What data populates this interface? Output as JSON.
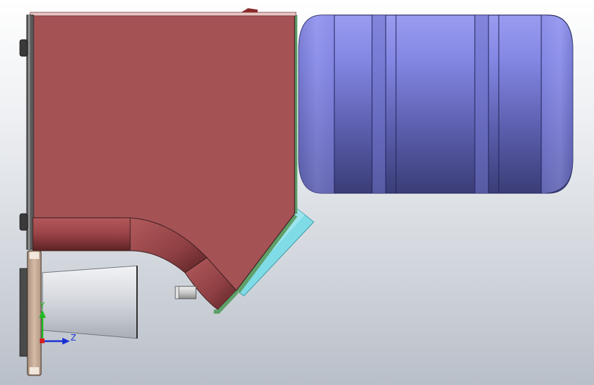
{
  "scene": {
    "triad": {
      "y_label": "Y",
      "z_label": "Z",
      "y_color": "#22bb22",
      "z_color": "#1a2fd6",
      "x_color": "#d81e1e"
    },
    "colors": {
      "housing": "#a55254",
      "housing_dark": "#7c3538",
      "tank": "#7f82e0",
      "tank_dark": "#3f4383",
      "funnel": "#d5d8de",
      "plate": "#c5a995",
      "hopper_side": "#7fdbe6",
      "edge_green": "#5fa06a"
    }
  }
}
